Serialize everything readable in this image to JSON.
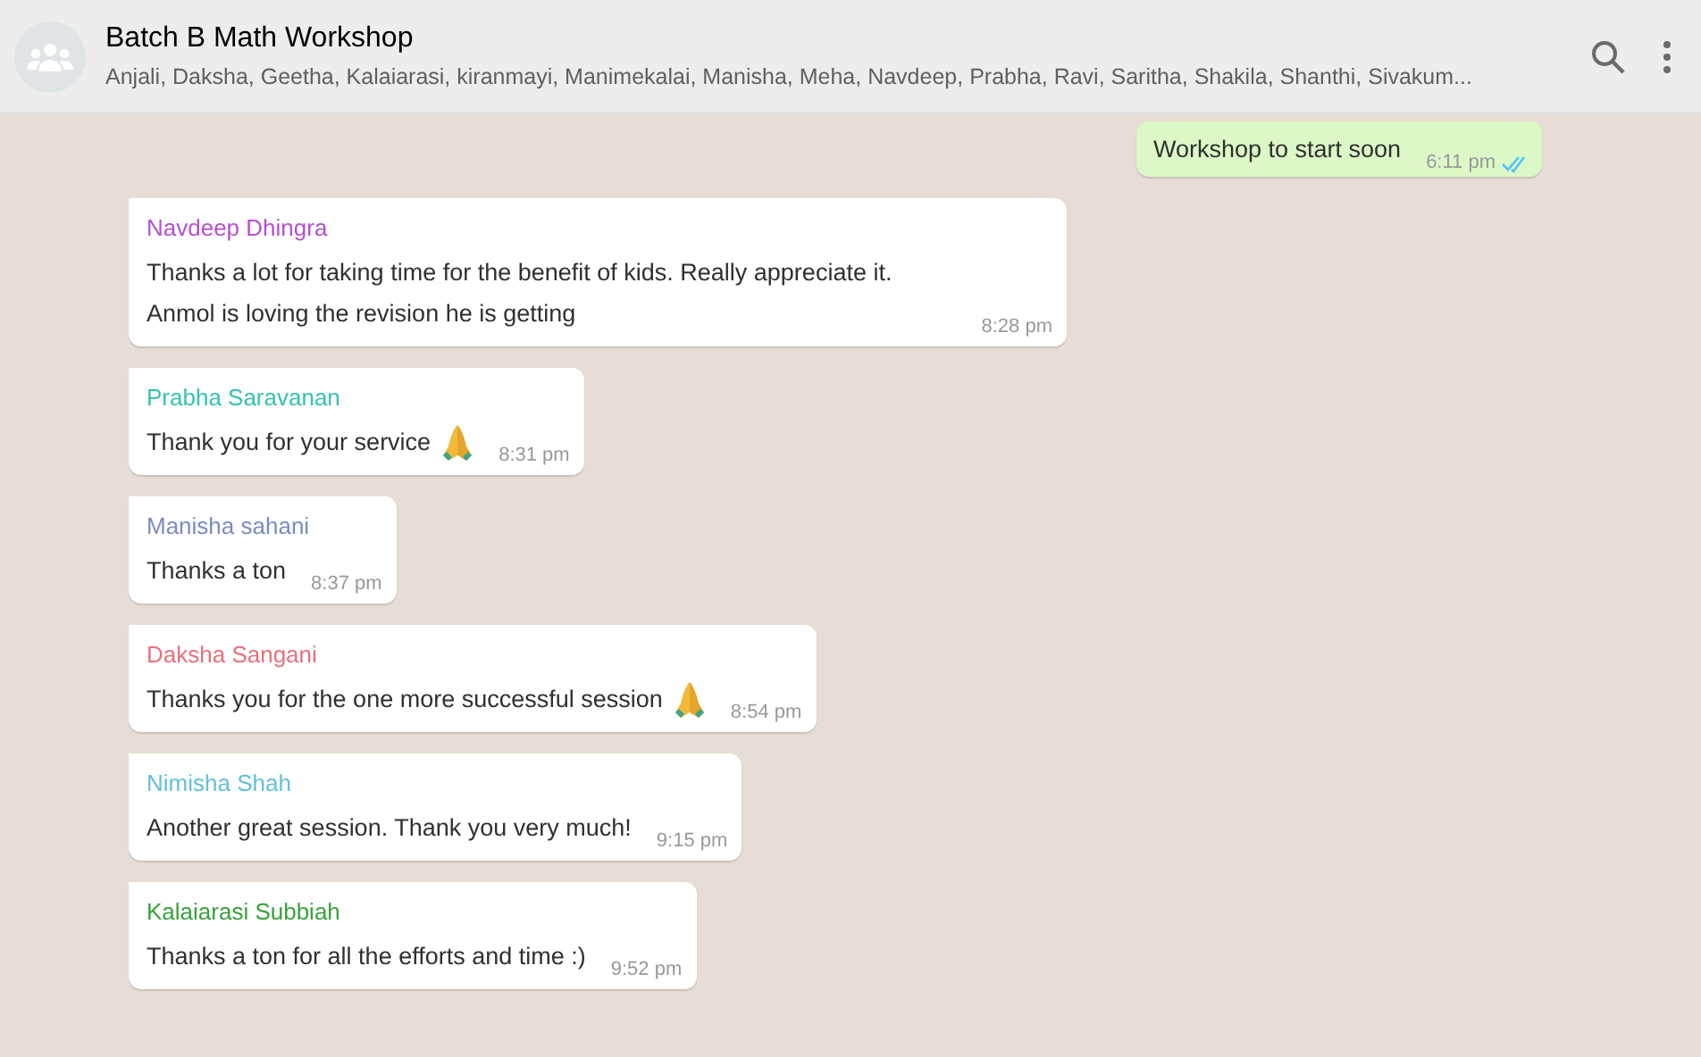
{
  "header": {
    "title": "Batch B Math Workshop",
    "members": "Anjali, Daksha, Geetha, Kalaiarasi, kiranmayi, Manimekalai, Manisha, Meha, Navdeep, Prabha, Ravi, Saritha, Shakila, Shanthi, Sivakum..."
  },
  "messages": [
    {
      "kind": "outgoing",
      "text": "Workshop to start soon",
      "time": "6:11 pm",
      "read": true
    },
    {
      "kind": "incoming",
      "sender": "Navdeep Dhingra",
      "color": "#b44fd0",
      "text": "Thanks a lot for taking time for the benefit of kids. Really appreciate it. Anmol is loving the revision he is getting",
      "time": "8:28 pm",
      "praying_hands": false
    },
    {
      "kind": "incoming",
      "sender": "Prabha Saravanan",
      "color": "#36c2b0",
      "text": "Thank you for your service",
      "time": "8:31 pm",
      "praying_hands": true
    },
    {
      "kind": "incoming",
      "sender": "Manisha sahani",
      "color": "#7b8bc2",
      "text": "Thanks a ton",
      "time": "8:37 pm",
      "praying_hands": false
    },
    {
      "kind": "incoming",
      "sender": "Daksha Sangani",
      "color": "#e8707c",
      "text": "Thanks you for the one more successful session",
      "time": "8:54 pm",
      "praying_hands": true
    },
    {
      "kind": "incoming",
      "sender": "Nimisha Shah",
      "color": "#64bfdc",
      "text": "Another great session. Thank you very much!",
      "time": "9:15 pm",
      "praying_hands": false
    },
    {
      "kind": "incoming",
      "sender": "Kalaiarasi Subbiah",
      "color": "#35a23a",
      "text": "Thanks a ton for all the efforts and time :)",
      "time": "9:52 pm",
      "praying_hands": false
    }
  ]
}
